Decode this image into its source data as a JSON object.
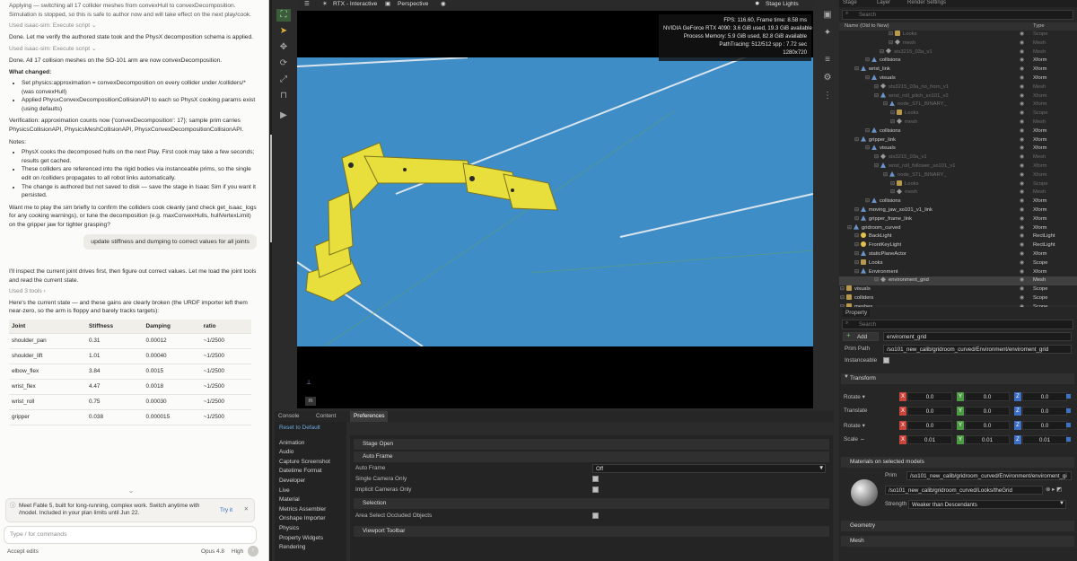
{
  "chat": {
    "line1": "Applying — switching all 17 collider meshes from convexHull to convexDecomposition. Simulation is stopped, so this is safe to author now and will take effect on the next play/cook.",
    "tool1": "Used isaac-sim: Execute script ⌄",
    "done1": "Done. Let me verify the authored state took and the PhysX decomposition schema is applied.",
    "tool2": "Used isaac-sim: Execute script ⌄",
    "done2": "Done. All 17 collision meshes on the SO-101 arm are now convexDecomposition.",
    "what_changed": "What changed:",
    "bullet1": "Set physics:approximation = convexDecomposition on every collider under /colliders/* (was convexHull)",
    "bullet2": "Applied PhysxConvexDecompositionCollisionAPI to each so PhysX cooking params exist (using defaults)",
    "verification": "Verification: approximation counts now {'convexDecomposition': 17}; sample prim carries PhysicsCollisionAPI, PhysicsMeshCollisionAPI, PhysxConvexDecompositionCollisionAPI.",
    "notes": "Notes:",
    "note1": "PhysX cooks the decomposed hulls on the next Play. First cook may take a few seconds; results get cached.",
    "note2": "These colliders are referenced into the rigid bodies via instanceable prims, so the single edit on /colliders propagates to all robot links automatically.",
    "note3": "The change is authored but not saved to disk — save the stage in Isaac Sim if you want it persisted.",
    "closing": "Want me to play the sim briefly to confirm the colliders cook cleanly (and check get_isaac_logs for any cooking warnings), or tune the decomposition (e.g. maxConvexHulls, hullVertexLimit) on the gripper jaw for tighter grasping?",
    "user_msg": "update stiffness and dumping to correct values for all joints",
    "reply1": "I'll inspect the current joint drives first, then figure out correct values. Let me load the joint tools and read the current state.",
    "tools3": "Used 3 tools ›",
    "reply2": "Here's the current state — and these gains are clearly broken (the URDF importer left them near-zero, so the arm is floppy and barely tracks targets):",
    "table_headers": [
      "Joint",
      "Stiffness",
      "Damping",
      "ratio"
    ],
    "table_rows": [
      [
        "shoulder_pan",
        "0.31",
        "0.00012",
        "~1/2500"
      ],
      [
        "shoulder_lift",
        "1.01",
        "0.00040",
        "~1/2500"
      ],
      [
        "elbow_flex",
        "3.84",
        "0.0015",
        "~1/2500"
      ],
      [
        "wrist_flex",
        "4.47",
        "0.0018",
        "~1/2500"
      ],
      [
        "wrist_roll",
        "0.75",
        "0.00030",
        "~1/2500"
      ],
      [
        "gripper",
        "0.038",
        "0.000015",
        "~1/2500"
      ]
    ],
    "promo_text": "Meet Fable 5, built for long-running, complex work. Switch anytime with /model. Included in your plan limits until Jun 22.",
    "promo_try": "Try it",
    "input_placeholder": "Type / for commands",
    "accept_edits": "Accept edits",
    "model": "Opus 4.8",
    "effort": "High"
  },
  "viewport": {
    "render_mode": "RTX - Interactive",
    "camera": "Perspective",
    "stage_lights": "Stage Lights",
    "stats": [
      "FPS: 116.60, Frame time: 8.58 ms",
      "NVIDIA GeForce RTX 4090: 3.6 GiB used, 19.3 GiB available",
      "Process Memory: 5.9 GiB used, 82.8 GiB available",
      "PathTracing: 512/512 spp : 7.72 sec",
      "1280x720"
    ],
    "axis_label": "m"
  },
  "bottom": {
    "tabs": [
      "Console",
      "Content",
      "Preferences"
    ],
    "reset": "Reset to Default",
    "pref_items": [
      "Animation",
      "Audio",
      "Capture Screenshot",
      "Datetime Format",
      "Developer",
      "Live",
      "Material",
      "Metrics Assembler",
      "Onshape Importer",
      "Physics",
      "Property Widgets",
      "Rendering"
    ],
    "stage_open": "Stage Open",
    "auto_frame_hdr": "Auto Frame",
    "auto_frame_label": "Auto Frame",
    "auto_frame_value": "Off",
    "single_camera": "Single Camera Only",
    "implicit_cameras": "Implicit Cameras Only",
    "selection": "Selection",
    "area_select": "Area Select Occluded Objects",
    "viewport_toolbar": "Viewport Toolbar"
  },
  "stage": {
    "tabs": [
      "Stage",
      "Layer",
      "Render Settings"
    ],
    "search_placeholder": "Search",
    "col_name": "Name (Old to New)",
    "col_type": "Type",
    "rows": [
      {
        "name": "Looks",
        "type": "Scope",
        "dim": true
      },
      {
        "name": "mesh",
        "type": "Mesh",
        "dim": true
      },
      {
        "name": "sts3215_03a_v1",
        "type": "Mesh",
        "dim": true
      },
      {
        "name": "collisions",
        "type": "Xform",
        "dim": false
      },
      {
        "name": "wrist_link",
        "type": "Xform",
        "dim": false
      },
      {
        "name": "visuals",
        "type": "Xform",
        "dim": false
      },
      {
        "name": "sts3215_03a_no_horn_v1",
        "type": "Mesh",
        "dim": true
      },
      {
        "name": "wrist_roll_pitch_so101_v2",
        "type": "Xform",
        "dim": true
      },
      {
        "name": "node_STL_BINARY_",
        "type": "Xform",
        "dim": true
      },
      {
        "name": "Looks",
        "type": "Scope",
        "dim": true
      },
      {
        "name": "mesh",
        "type": "Mesh",
        "dim": true
      },
      {
        "name": "collisions",
        "type": "Xform",
        "dim": false
      },
      {
        "name": "gripper_link",
        "type": "Xform",
        "dim": false
      },
      {
        "name": "visuals",
        "type": "Xform",
        "dim": false
      },
      {
        "name": "sts3215_03a_v1",
        "type": "Mesh",
        "dim": true
      },
      {
        "name": "wrist_roll_follower_so101_v1",
        "type": "Xform",
        "dim": true
      },
      {
        "name": "node_STL_BINARY_",
        "type": "Xform",
        "dim": true
      },
      {
        "name": "Looks",
        "type": "Scope",
        "dim": true
      },
      {
        "name": "mesh",
        "type": "Mesh",
        "dim": true
      },
      {
        "name": "collisions",
        "type": "Xform",
        "dim": false
      },
      {
        "name": "moving_jaw_so101_v1_link",
        "type": "Xform",
        "dim": false
      },
      {
        "name": "gripper_frame_link",
        "type": "Xform",
        "dim": false
      },
      {
        "name": "gridroom_curved",
        "type": "Xform",
        "dim": false
      },
      {
        "name": "BackLight",
        "type": "RectLight",
        "dim": false
      },
      {
        "name": "FrontKeyLight",
        "type": "RectLight",
        "dim": false
      },
      {
        "name": "staticPlaneActor",
        "type": "Xform",
        "dim": false
      },
      {
        "name": "Looks",
        "type": "Scope",
        "dim": false
      },
      {
        "name": "Environment",
        "type": "Xform",
        "dim": false
      },
      {
        "name": "environment_grid",
        "type": "Mesh",
        "dim": false,
        "selected": true
      },
      {
        "name": "visuals",
        "type": "Scope",
        "dim": false
      },
      {
        "name": "colliders",
        "type": "Scope",
        "dim": false
      },
      {
        "name": "meshes",
        "type": "Scope",
        "dim": false
      }
    ]
  },
  "property": {
    "title": "Property",
    "search_placeholder": "Search",
    "add_label": "Add",
    "name_value": "enviroment_grid",
    "prim_path_label": "Prim Path",
    "prim_path_value": "/so101_new_calib/gridroom_curved/Environment/enviroment_grid",
    "instanceable_label": "Instanceable",
    "transform_label": "Transform",
    "rotate_label": "Rotate ▾",
    "translate_label": "Translate",
    "rotate2_label": "Rotate ▾",
    "scale_label": "Scale ⇔",
    "rotate_vals": [
      "0.0",
      "0.0",
      "0.0"
    ],
    "translate_vals": [
      "0.0",
      "0.0",
      "0.0"
    ],
    "rotate2_vals": [
      "0.0",
      "0.0",
      "0.0"
    ],
    "scale_vals": [
      "0.01",
      "0.01",
      "0.01"
    ],
    "materials_label": "Materials on selected models",
    "prim_label": "Prim",
    "prim_value": "/so101_new_calib/gridroom_curved/Environment/enviroment_gi",
    "material_path": "/so101_new_calib/gridroom_curved/Looks/theGrid",
    "strength_label": "Strength",
    "strength_value": "Weaker than Descendants",
    "geometry_label": "Geometry",
    "mesh_label": "Mesh"
  }
}
